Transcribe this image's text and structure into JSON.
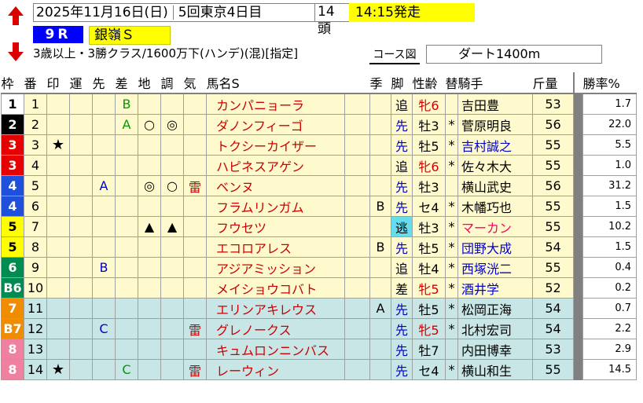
{
  "header": {
    "date_line": "2025年11月16日(日)",
    "meeting": "5回東京4日目",
    "heads": "14頭",
    "start_time": "14:15発走",
    "race_no": "9R",
    "race_name": "銀嶺Ｓ",
    "conditions": "3歳以上・3勝クラス/1600万下(ハンデ)(混)[指定]",
    "course_label": "コース図",
    "course": "ダート1400m"
  },
  "columns": [
    "枠",
    "番",
    "印",
    "運",
    "先",
    "差",
    "地",
    "調",
    "気",
    "馬名S",
    "",
    "季",
    "脚",
    "性齢",
    "替",
    "騎手",
    "斤量",
    "",
    "勝率%"
  ],
  "waku_colors": {
    "1": {
      "bg": "#ffffff",
      "fg": "#000000"
    },
    "2": {
      "bg": "#000000",
      "fg": "#ffffff"
    },
    "3": {
      "bg": "#e60000",
      "fg": "#ffffff"
    },
    "4": {
      "bg": "#1e50dc",
      "fg": "#ffffff"
    },
    "5": {
      "bg": "#ffff00",
      "fg": "#000000"
    },
    "6": {
      "bg": "#008c50",
      "fg": "#ffffff"
    },
    "7": {
      "bg": "#f08c00",
      "fg": "#ffffff"
    },
    "8": {
      "bg": "#f080a0",
      "fg": "#ffffff"
    }
  },
  "rows": [
    {
      "waku": "1",
      "num": "1",
      "mark": "",
      "un": "",
      "saki": "",
      "sa": "B",
      "chi": "",
      "cho": "",
      "ki": "",
      "name": "カンパニョーラ",
      "kisetsu": "",
      "kyaku": "追",
      "sexage": "牝6",
      "sex_red": true,
      "kae": "",
      "jockey": "吉田豊",
      "jockey_blue": false,
      "weight": "53",
      "rate": "1.7",
      "bg": "#fffacd"
    },
    {
      "waku": "2",
      "num": "2",
      "mark": "",
      "un": "",
      "saki": "",
      "sa": "A",
      "chi": "○",
      "cho": "◎",
      "ki": "",
      "name": "ダノンフィーゴ",
      "kisetsu": "",
      "kyaku": "先",
      "sexage": "牡3",
      "sex_red": false,
      "kae": "*",
      "jockey": "菅原明良",
      "jockey_blue": false,
      "weight": "56",
      "rate": "22.0",
      "bg": "#fffacd"
    },
    {
      "waku": "3",
      "num": "3",
      "mark": "★",
      "un": "",
      "saki": "",
      "sa": "",
      "chi": "",
      "cho": "",
      "ki": "",
      "name": "トクシーカイザー",
      "kisetsu": "",
      "kyaku": "先",
      "sexage": "牡5",
      "sex_red": false,
      "kae": "*",
      "jockey": "吉村誠之",
      "jockey_blue": true,
      "weight": "55",
      "rate": "5.5",
      "bg": "#fffacd"
    },
    {
      "waku": "3",
      "num": "4",
      "mark": "",
      "un": "",
      "saki": "",
      "sa": "",
      "chi": "",
      "cho": "",
      "ki": "",
      "name": "ハピネスアゲン",
      "kisetsu": "",
      "kyaku": "追",
      "sexage": "牝6",
      "sex_red": true,
      "kae": "*",
      "jockey": "佐々木大",
      "jockey_blue": false,
      "weight": "55",
      "rate": "1.0",
      "bg": "#fffacd"
    },
    {
      "waku": "4",
      "num": "5",
      "mark": "",
      "un": "",
      "saki": "A",
      "sa": "",
      "chi": "◎",
      "cho": "○",
      "ki": "雷",
      "name": "ベンヌ",
      "kisetsu": "",
      "kyaku": "先",
      "sexage": "牡3",
      "sex_red": false,
      "kae": "",
      "jockey": "横山武史",
      "jockey_blue": false,
      "weight": "56",
      "rate": "31.2",
      "bg": "#fffacd"
    },
    {
      "waku": "4",
      "num": "6",
      "mark": "",
      "un": "",
      "saki": "",
      "sa": "",
      "chi": "",
      "cho": "",
      "ki": "",
      "name": "フラムリンガム",
      "kisetsu": "B",
      "kyaku": "先",
      "sexage": "セ4",
      "sex_red": false,
      "kae": "*",
      "jockey": "木幡巧也",
      "jockey_blue": false,
      "weight": "55",
      "rate": "1.5",
      "bg": "#fffacd"
    },
    {
      "waku": "5",
      "num": "7",
      "mark": "",
      "un": "",
      "saki": "",
      "sa": "",
      "chi": "▲",
      "cho": "▲",
      "ki": "",
      "name": "フウセツ",
      "kisetsu": "",
      "kyaku": "逃",
      "sexage": "牡3",
      "sex_red": false,
      "kae": "*",
      "jockey": "マーカン",
      "jockey_blue": false,
      "jockey_red": true,
      "weight": "55",
      "rate": "10.2",
      "bg": "#fffacd",
      "nige": true
    },
    {
      "waku": "5",
      "num": "8",
      "mark": "",
      "un": "",
      "saki": "",
      "sa": "",
      "chi": "",
      "cho": "",
      "ki": "",
      "name": "エコロアレス",
      "kisetsu": "B",
      "kyaku": "先",
      "sexage": "牡5",
      "sex_red": false,
      "kae": "*",
      "jockey": "団野大成",
      "jockey_blue": true,
      "weight": "54",
      "rate": "1.5",
      "bg": "#fffacd"
    },
    {
      "waku": "6",
      "num": "9",
      "mark": "",
      "un": "",
      "saki": "B",
      "sa": "",
      "chi": "",
      "cho": "",
      "ki": "",
      "name": "アジアミッション",
      "kisetsu": "",
      "kyaku": "追",
      "sexage": "牡4",
      "sex_red": false,
      "kae": "*",
      "jockey": "西塚洸二",
      "jockey_blue": true,
      "weight": "55",
      "rate": "0.4",
      "bg": "#fffacd"
    },
    {
      "waku": "B6",
      "num": "10",
      "mark": "",
      "un": "",
      "saki": "",
      "sa": "",
      "chi": "",
      "cho": "",
      "ki": "",
      "name": "メイショウコバト",
      "kisetsu": "",
      "kyaku": "差",
      "sexage": "牝5",
      "sex_red": true,
      "kae": "*",
      "jockey": "酒井学",
      "jockey_blue": true,
      "weight": "52",
      "rate": "0.2",
      "bg": "#fffacd",
      "waku_num": "6"
    },
    {
      "waku": "7",
      "num": "11",
      "mark": "",
      "un": "",
      "saki": "",
      "sa": "",
      "chi": "",
      "cho": "",
      "ki": "",
      "name": "エリンアキレウス",
      "kisetsu": "A",
      "kyaku": "先",
      "sexage": "牡5",
      "sex_red": false,
      "kae": "*",
      "jockey": "松岡正海",
      "jockey_blue": false,
      "weight": "54",
      "rate": "0.7",
      "bg": "#c8e6e6"
    },
    {
      "waku": "B7",
      "num": "12",
      "mark": "",
      "un": "",
      "saki": "C",
      "sa": "",
      "chi": "",
      "cho": "",
      "ki": "雷",
      "name": "グレノークス",
      "kisetsu": "",
      "kyaku": "先",
      "sexage": "牝5",
      "sex_red": true,
      "kae": "*",
      "jockey": "北村宏司",
      "jockey_blue": false,
      "weight": "54",
      "rate": "2.2",
      "bg": "#c8e6e6",
      "waku_num": "7"
    },
    {
      "waku": "8",
      "num": "13",
      "mark": "",
      "un": "",
      "saki": "",
      "sa": "",
      "chi": "",
      "cho": "",
      "ki": "",
      "name": "キュムロンニンバス",
      "kisetsu": "",
      "kyaku": "先",
      "sexage": "牡7",
      "sex_red": false,
      "kae": "",
      "jockey": "内田博幸",
      "jockey_blue": false,
      "weight": "53",
      "rate": "2.9",
      "bg": "#c8e6e6"
    },
    {
      "waku": "8",
      "num": "14",
      "mark": "★",
      "un": "",
      "saki": "",
      "sa": "C",
      "chi": "",
      "cho": "",
      "ki": "雷",
      "name": "レーウィン",
      "kisetsu": "",
      "kyaku": "先",
      "sexage": "セ4",
      "sex_red": false,
      "kae": "*",
      "jockey": "横山和生",
      "jockey_blue": false,
      "weight": "55",
      "rate": "14.5",
      "bg": "#c8e6e6"
    }
  ]
}
